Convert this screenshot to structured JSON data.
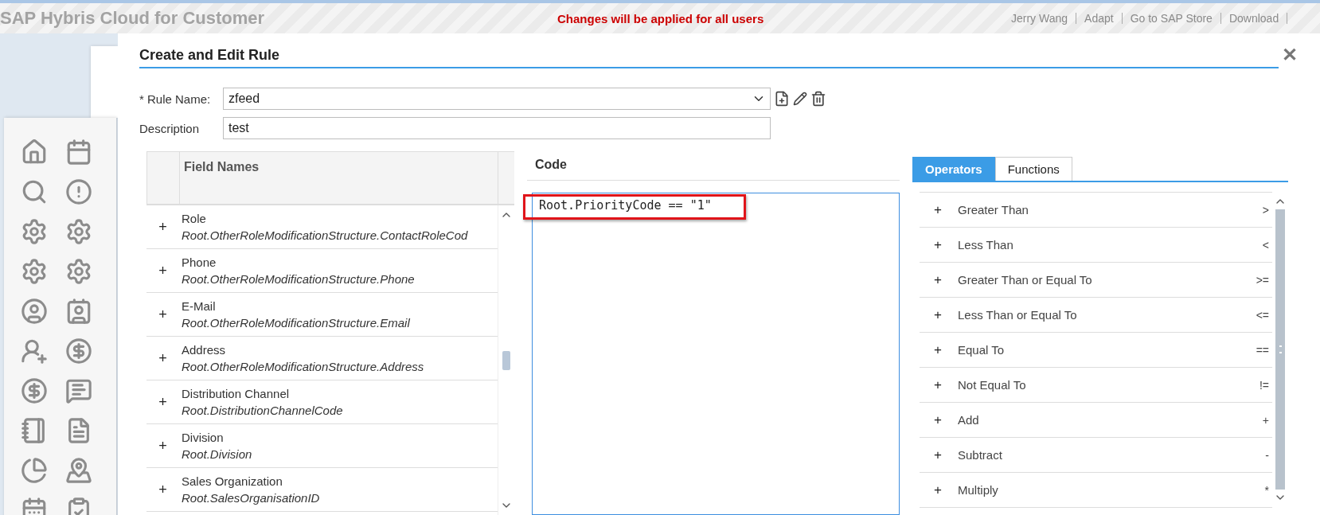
{
  "top_bar": {
    "title": "SAP Hybris Cloud for Customer",
    "notice": "Changes will be applied for all users",
    "links": [
      "Jerry Wang",
      "Adapt",
      "Go to SAP Store",
      "Download"
    ]
  },
  "dialog": {
    "title": "Create and Edit Rule",
    "close": "✕",
    "rule_name": {
      "label": "* Rule Name:",
      "value": "zfeed"
    },
    "description": {
      "label": "Description",
      "value": "test"
    },
    "field_table": {
      "header": "Field Names",
      "rows": [
        {
          "expander": "+",
          "label": "Role",
          "path": "Root.OtherRoleModificationStructure.ContactRoleCod"
        },
        {
          "expander": "+",
          "label": "Phone",
          "path": "Root.OtherRoleModificationStructure.Phone"
        },
        {
          "expander": "+",
          "label": "E-Mail",
          "path": "Root.OtherRoleModificationStructure.Email"
        },
        {
          "expander": "+",
          "label": "Address",
          "path": "Root.OtherRoleModificationStructure.Address"
        },
        {
          "expander": "+",
          "label": "Distribution Channel",
          "path": "Root.DistributionChannelCode"
        },
        {
          "expander": "+",
          "label": "Division",
          "path": "Root.Division"
        },
        {
          "expander": "+",
          "label": "Sales Organization",
          "path": "Root.SalesOrganisationID"
        }
      ]
    },
    "code": {
      "label": "Code",
      "value": "Root.PriorityCode == \"1\"",
      "highlighted": true
    },
    "tabs": [
      {
        "label": "Operators",
        "selected": true
      },
      {
        "label": "Functions",
        "selected": false
      }
    ],
    "operators": [
      {
        "expander": "+",
        "label": "Greater Than",
        "symbol": ">"
      },
      {
        "expander": "+",
        "label": "Less Than",
        "symbol": "<"
      },
      {
        "expander": "+",
        "label": "Greater Than or Equal To",
        "symbol": ">="
      },
      {
        "expander": "+",
        "label": "Less Than or Equal To",
        "symbol": "<="
      },
      {
        "expander": "+",
        "label": "Equal To",
        "symbol": "=="
      },
      {
        "expander": "+",
        "label": "Not Equal To",
        "symbol": "!="
      },
      {
        "expander": "+",
        "label": "Add",
        "symbol": "+"
      },
      {
        "expander": "+",
        "label": "Subtract",
        "symbol": "-"
      },
      {
        "expander": "+",
        "label": "Multiply",
        "symbol": "*"
      }
    ]
  }
}
